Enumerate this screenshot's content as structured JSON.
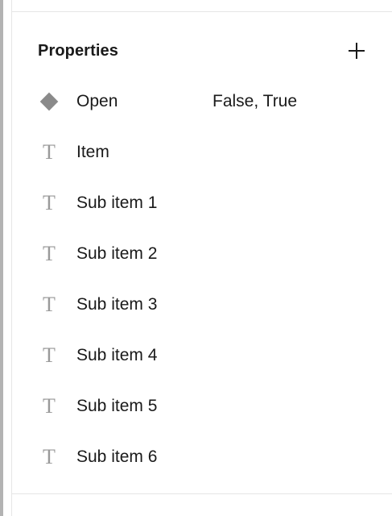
{
  "panel": {
    "title": "Properties",
    "add_icon": "plus-icon"
  },
  "properties": [
    {
      "type": "variant",
      "icon": "variant-diamond-icon",
      "label": "Open",
      "value": "False, True"
    },
    {
      "type": "text",
      "icon": "text-icon",
      "icon_glyph": "T",
      "label": "Item",
      "value": ""
    },
    {
      "type": "text",
      "icon": "text-icon",
      "icon_glyph": "T",
      "label": "Sub item 1",
      "value": ""
    },
    {
      "type": "text",
      "icon": "text-icon",
      "icon_glyph": "T",
      "label": "Sub item 2",
      "value": ""
    },
    {
      "type": "text",
      "icon": "text-icon",
      "icon_glyph": "T",
      "label": "Sub item 3",
      "value": ""
    },
    {
      "type": "text",
      "icon": "text-icon",
      "icon_glyph": "T",
      "label": "Sub item 4",
      "value": ""
    },
    {
      "type": "text",
      "icon": "text-icon",
      "icon_glyph": "T",
      "label": "Sub item 5",
      "value": ""
    },
    {
      "type": "text",
      "icon": "text-icon",
      "icon_glyph": "T",
      "label": "Sub item 6",
      "value": ""
    }
  ],
  "colors": {
    "icon_gray": "#8a8a8a",
    "divider": "#e6e6e6",
    "text": "#1a1a1a"
  }
}
